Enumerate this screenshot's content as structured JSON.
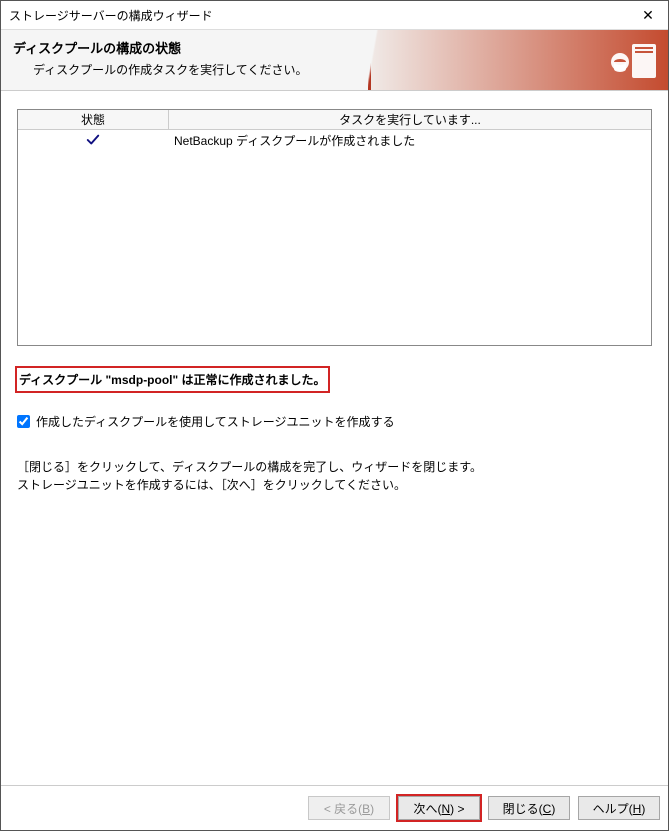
{
  "window": {
    "title": "ストレージサーバーの構成ウィザード"
  },
  "banner": {
    "heading": "ディスクプールの構成の状態",
    "sub": "ディスクプールの作成タスクを実行してください。"
  },
  "table": {
    "head_status": "状態",
    "head_task": "タスクを実行しています...",
    "rows": [
      {
        "status_icon": "check",
        "task": "NetBackup ディスクプールが作成されました"
      }
    ]
  },
  "result_text": "ディスクプール \"msdp-pool\" は正常に作成されました。",
  "checkbox_label": "作成したディスクプールを使用してストレージユニットを作成する",
  "checkbox_checked": true,
  "hint_line1": "［閉じる］をクリックして、ディスクプールの構成を完了し、ウィザードを閉じます。",
  "hint_line2": "ストレージユニットを作成するには、［次へ］をクリックしてください。",
  "buttons": {
    "back": "< 戻る(B)",
    "next": "次へ(N) >",
    "close": "閉じる(C)",
    "help": "ヘルプ(H)"
  }
}
